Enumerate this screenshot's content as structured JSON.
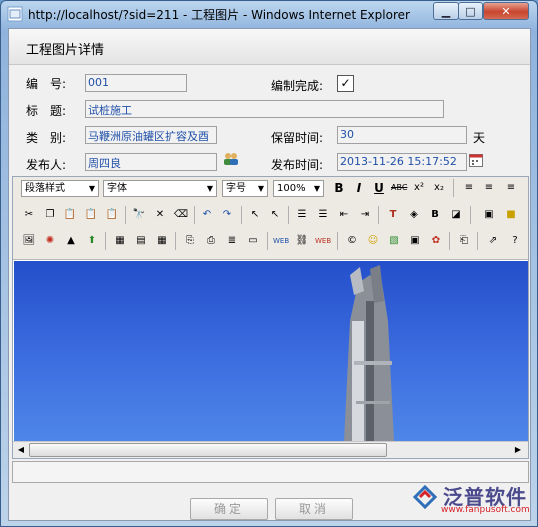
{
  "window": {
    "title": "http://localhost/?sid=211 - 工程图片 - Windows Internet Explorer"
  },
  "dialog": {
    "title": "工程图片详情"
  },
  "form": {
    "number_label": "编　号:",
    "number_value": "001",
    "compiled_label": "编制完成:",
    "compiled_checked": true,
    "compiled_mark": "✓",
    "title_label": "标　题:",
    "title_value": "试桩施工",
    "category_label": "类　别:",
    "category_value": "马鞭洲原油罐区扩容及酉",
    "retention_label": "保留时间:",
    "retention_value": "30",
    "retention_unit": "天",
    "publisher_label": "发布人:",
    "publisher_value": "周四良",
    "publish_time_label": "发布时间:",
    "publish_time_value": "2013-11-26 15:17:52"
  },
  "toolbar": {
    "paragraph_style": "段落样式",
    "font": "字体",
    "font_size": "字号",
    "zoom": "100%"
  },
  "buttons": {
    "ok": "确定",
    "cancel": "取消"
  },
  "logo": {
    "name": "泛普软件",
    "url": "www.fanpusoft.com"
  }
}
